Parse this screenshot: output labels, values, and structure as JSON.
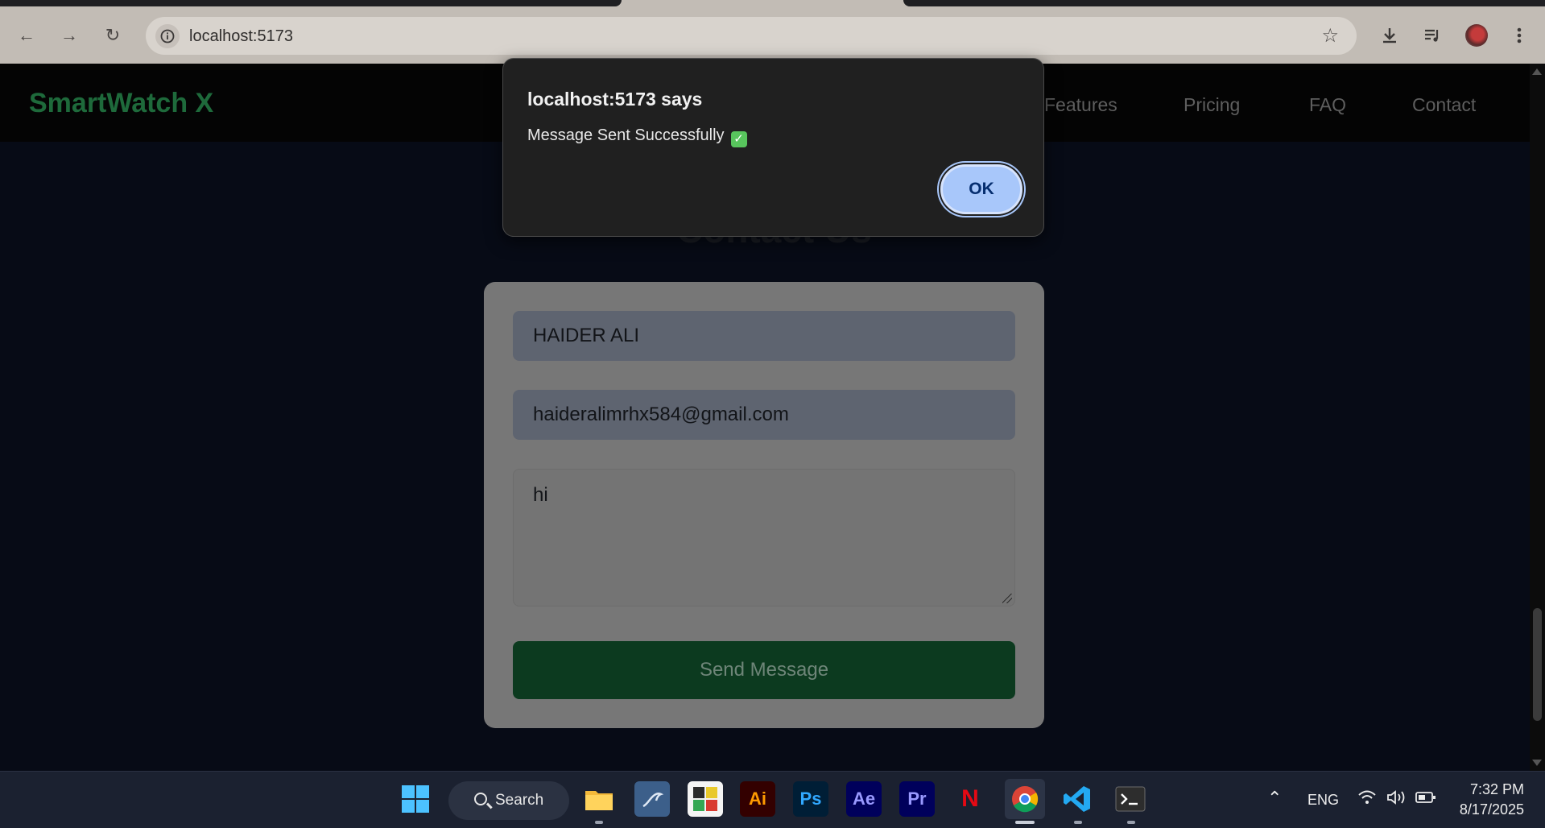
{
  "browser": {
    "url": "localhost:5173"
  },
  "site": {
    "brand": "SmartWatch X",
    "nav": [
      "Features",
      "Pricing",
      "FAQ",
      "Contact"
    ],
    "section_heading": "Contact Us"
  },
  "form": {
    "name_value": "HAIDER ALI",
    "email_value": "haideralimrhx584@gmail.com",
    "message_value": "hi",
    "submit_label": "Send Message"
  },
  "dialog": {
    "title": "localhost:5173 says",
    "message": "Message Sent Successfully",
    "ok_label": "OK"
  },
  "taskbar": {
    "search_label": "Search",
    "apps": [
      "file-explorer",
      "mysql-workbench",
      "game",
      "illustrator",
      "photoshop",
      "after-effects",
      "premiere-pro",
      "netflix",
      "chrome",
      "vscode",
      "terminal"
    ],
    "app_labels": {
      "illustrator": "Ai",
      "photoshop": "Ps",
      "after_effects": "Ae",
      "premiere": "Pr",
      "netflix": "N"
    },
    "language": "ENG",
    "time": "7:32 PM",
    "date": "8/17/2025"
  },
  "colors": {
    "brand_green": "#1e6a3b",
    "button_green": "#0c3a1f",
    "dialog_ok": "#a8c7fa"
  }
}
